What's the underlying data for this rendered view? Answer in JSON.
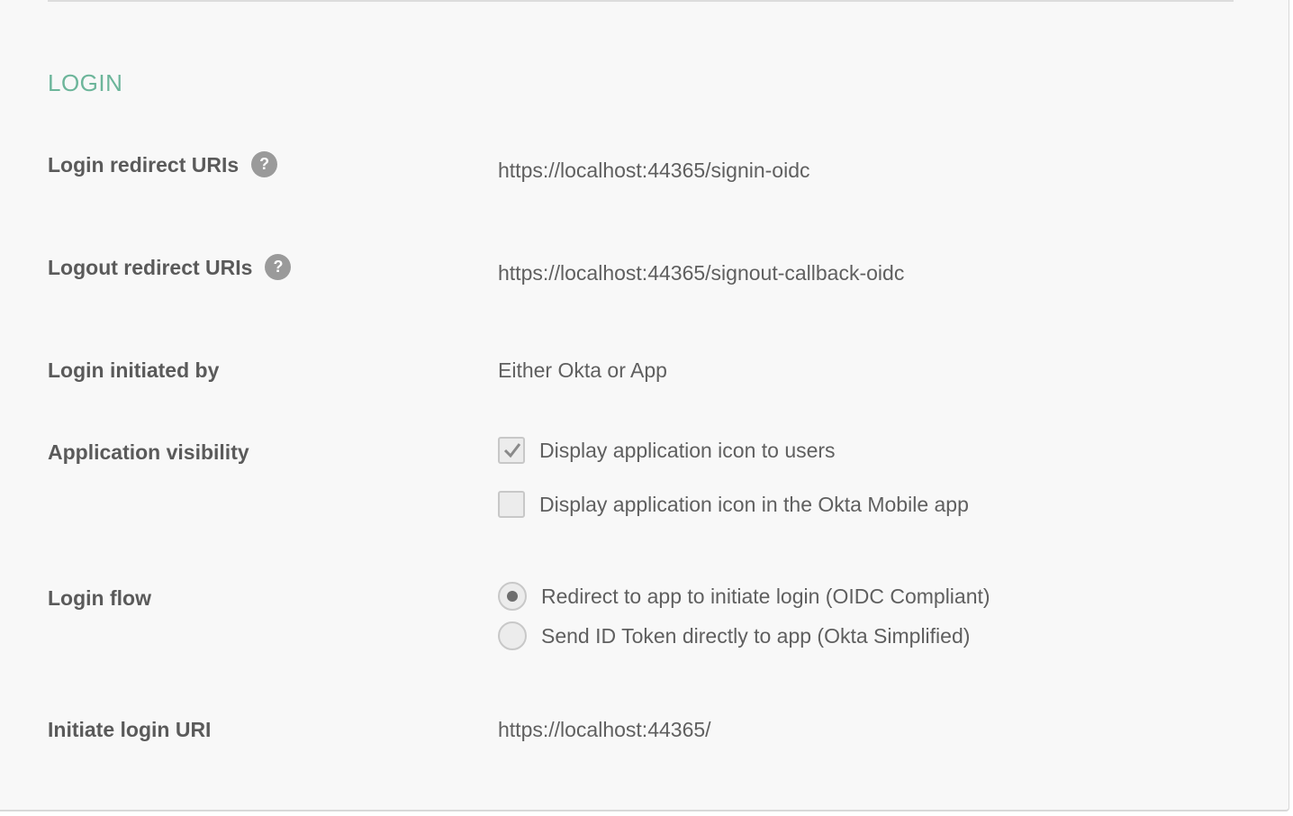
{
  "section": {
    "title": "LOGIN"
  },
  "fields": {
    "login_redirect": {
      "label": "Login redirect URIs",
      "help_icon": "?",
      "value": "https://localhost:44365/signin-oidc"
    },
    "logout_redirect": {
      "label": "Logout redirect URIs",
      "help_icon": "?",
      "value": "https://localhost:44365/signout-callback-oidc"
    },
    "login_initiated_by": {
      "label": "Login initiated by",
      "value": "Either Okta or App"
    },
    "app_visibility": {
      "label": "Application visibility",
      "options": [
        {
          "label": "Display application icon to users",
          "checked": true
        },
        {
          "label": "Display application icon in the Okta Mobile app",
          "checked": false
        }
      ]
    },
    "login_flow": {
      "label": "Login flow",
      "options": [
        {
          "label": "Redirect to app to initiate login (OIDC Compliant)",
          "selected": true
        },
        {
          "label": "Send ID Token directly to app (Okta Simplified)",
          "selected": false
        }
      ]
    },
    "initiate_login_uri": {
      "label": "Initiate login URI",
      "value": "https://localhost:44365/"
    }
  },
  "colors": {
    "section_title": "#6cb59a",
    "label": "#5a5a5a",
    "value": "#5f5f5f",
    "help_icon_bg": "#9a9a9a",
    "panel_bg": "#f8f8f8"
  }
}
